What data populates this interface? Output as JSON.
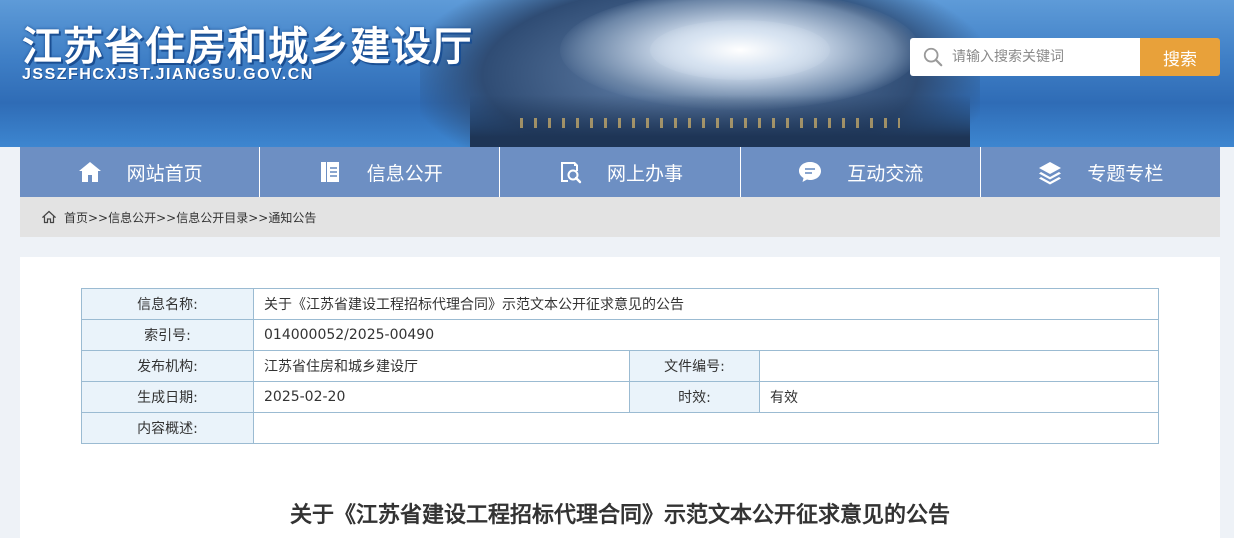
{
  "header": {
    "site_title": "江苏省住房和城乡建设厅",
    "site_domain": "JSSZFHCXJST.JIANGSU.GOV.CN",
    "search_placeholder": "请输入搜索关键词",
    "search_button": "搜索"
  },
  "nav": {
    "items": [
      {
        "label": "网站首页",
        "icon": "home-icon"
      },
      {
        "label": "信息公开",
        "icon": "document-icon"
      },
      {
        "label": "网上办事",
        "icon": "search-document-icon"
      },
      {
        "label": "互动交流",
        "icon": "chat-bubble-icon"
      },
      {
        "label": "专题专栏",
        "icon": "layers-icon"
      }
    ]
  },
  "breadcrumb": {
    "text": "首页>>信息公开>>信息公开目录>>通知公告"
  },
  "info_table": {
    "name_label": "信息名称:",
    "name_value": "关于《江苏省建设工程招标代理合同》示范文本公开征求意见的公告",
    "index_label": "索引号:",
    "index_value": "014000052/2025-00490",
    "org_label": "发布机构:",
    "org_value": "江苏省住房和城乡建设厅",
    "docno_label": "文件编号:",
    "docno_value": "",
    "date_label": "生成日期:",
    "date_value": "2025-02-20",
    "validity_label": "时效:",
    "validity_value": "有效",
    "summary_label": "内容概述:",
    "summary_value": ""
  },
  "article": {
    "title": "关于《江苏省建设工程招标代理合同》示范文本公开征求意见的公告"
  },
  "colors": {
    "nav_bg": "#6d8fc3",
    "search_button": "#e8a13a",
    "table_border": "#9bbbd2",
    "label_bg": "#eaf3fa"
  }
}
